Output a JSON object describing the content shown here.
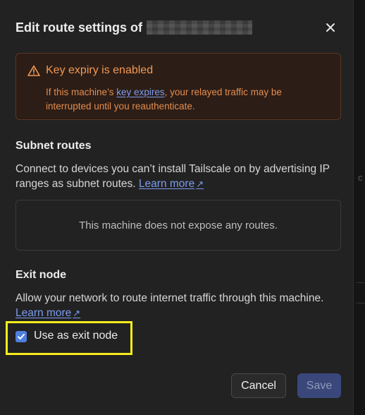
{
  "dialog": {
    "title": "Edit route settings of",
    "close_icon": "close-icon"
  },
  "alert": {
    "icon": "warning-icon",
    "title": "Key expiry is enabled",
    "body_prefix": "If this machine’s ",
    "link_text": "key expires",
    "body_suffix": ", your relayed traffic may be interrupted until you reauthenticate.",
    "color": "#f19a55"
  },
  "subnet": {
    "title": "Subnet routes",
    "description": "Connect to devices you can’t install Tailscale on by advertising IP ranges as subnet routes. ",
    "learn_more": "Learn more",
    "arrow": "↗",
    "empty_text": "This machine does not expose any routes."
  },
  "exit_node": {
    "title": "Exit node",
    "description": "Allow your network to route internet traffic through this machine. ",
    "learn_more": "Learn more",
    "arrow": "↗",
    "checkbox_label": "Use as exit node",
    "checked": true
  },
  "footer": {
    "cancel_label": "Cancel",
    "save_label": "Save"
  },
  "background": {
    "partial_glyph": "c"
  },
  "colors": {
    "accent": "#4e7fe0",
    "link": "#7c9cf0",
    "highlight": "#f6ec1c",
    "save_disabled_bg": "#39477a"
  }
}
